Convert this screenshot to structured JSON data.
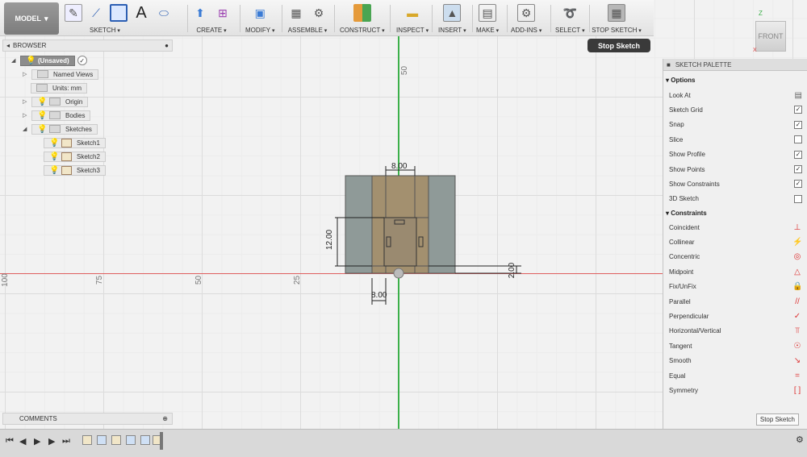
{
  "toolbar": {
    "model_label": "MODEL",
    "groups": [
      "SKETCH",
      "CREATE",
      "MODIFY",
      "ASSEMBLE",
      "CONSTRUCT",
      "INSPECT",
      "INSERT",
      "MAKE",
      "ADD-INS",
      "SELECT",
      "STOP SKETCH"
    ]
  },
  "tooltip": "Stop Sketch",
  "viewcube": {
    "face": "FRONT",
    "z": "Z",
    "x": "X"
  },
  "browser": {
    "title": "BROWSER",
    "root": "(Unsaved)",
    "items": [
      "Named Views",
      "Units: mm",
      "Origin",
      "Bodies",
      "Sketches"
    ],
    "sketches": [
      "Sketch1",
      "Sketch2",
      "Sketch3"
    ]
  },
  "comments": "COMMENTS",
  "canvas": {
    "axis_labels": [
      "100",
      "75",
      "50",
      "25",
      "50"
    ],
    "dimensions": [
      "8.00",
      "12.00",
      "2.00",
      "8.00"
    ]
  },
  "palette": {
    "title": "SKETCH PALETTE",
    "options_header": "Options",
    "options": [
      {
        "label": "Look At",
        "check": ""
      },
      {
        "label": "Sketch Grid",
        "check": "✓"
      },
      {
        "label": "Snap",
        "check": "✓"
      },
      {
        "label": "Slice",
        "check": ""
      },
      {
        "label": "Show Profile",
        "check": "✓"
      },
      {
        "label": "Show Points",
        "check": "✓"
      },
      {
        "label": "Show Constraints",
        "check": "✓"
      },
      {
        "label": "3D Sketch",
        "check": ""
      }
    ],
    "constraints_header": "Constraints",
    "constraints": [
      {
        "label": "Coincident",
        "icon": "⊥"
      },
      {
        "label": "Collinear",
        "icon": "⚡"
      },
      {
        "label": "Concentric",
        "icon": "◎"
      },
      {
        "label": "Midpoint",
        "icon": "△"
      },
      {
        "label": "Fix/UnFix",
        "icon": "🔒"
      },
      {
        "label": "Parallel",
        "icon": "//"
      },
      {
        "label": "Perpendicular",
        "icon": "✓"
      },
      {
        "label": "Horizontal/Vertical",
        "icon": "⫪"
      },
      {
        "label": "Tangent",
        "icon": "☉"
      },
      {
        "label": "Smooth",
        "icon": "↘"
      },
      {
        "label": "Equal",
        "icon": "="
      },
      {
        "label": "Symmetry",
        "icon": "[ ]"
      }
    ],
    "stop_button": "Stop Sketch"
  }
}
